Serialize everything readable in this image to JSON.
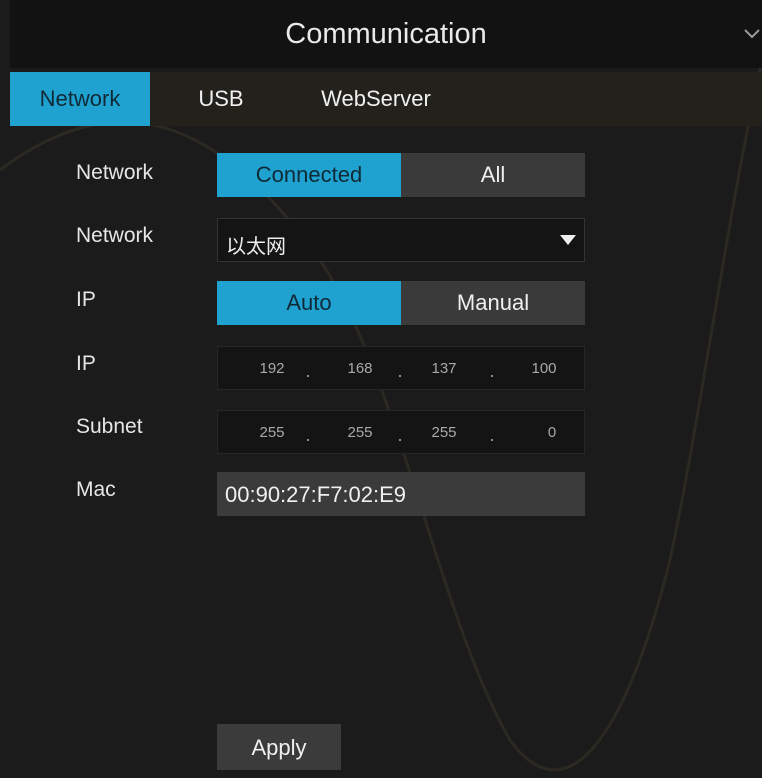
{
  "window": {
    "title": "Communication"
  },
  "tabs": [
    {
      "label": "Network",
      "active": true
    },
    {
      "label": "USB",
      "active": false
    },
    {
      "label": "WebServer",
      "active": false
    }
  ],
  "form": {
    "network_filter": {
      "label": "Network",
      "options": [
        "Connected",
        "All"
      ],
      "selected": "Connected"
    },
    "network_select": {
      "label": "Network",
      "value": "以太网"
    },
    "ip_mode": {
      "label": "IP",
      "options": [
        "Auto",
        "Manual"
      ],
      "selected": "Auto"
    },
    "ip_address": {
      "label": "IP",
      "octets": [
        "192",
        "168",
        "137",
        "100"
      ]
    },
    "subnet": {
      "label": "Subnet",
      "octets": [
        "255",
        "255",
        "255",
        "0"
      ]
    },
    "mac": {
      "label": "Mac",
      "value": "00:90:27:F7:02:E9"
    }
  },
  "actions": {
    "apply_label": "Apply"
  },
  "colors": {
    "accent": "#1fa2d0",
    "background": "#1b1b1b",
    "control": "#3b3b3b"
  }
}
